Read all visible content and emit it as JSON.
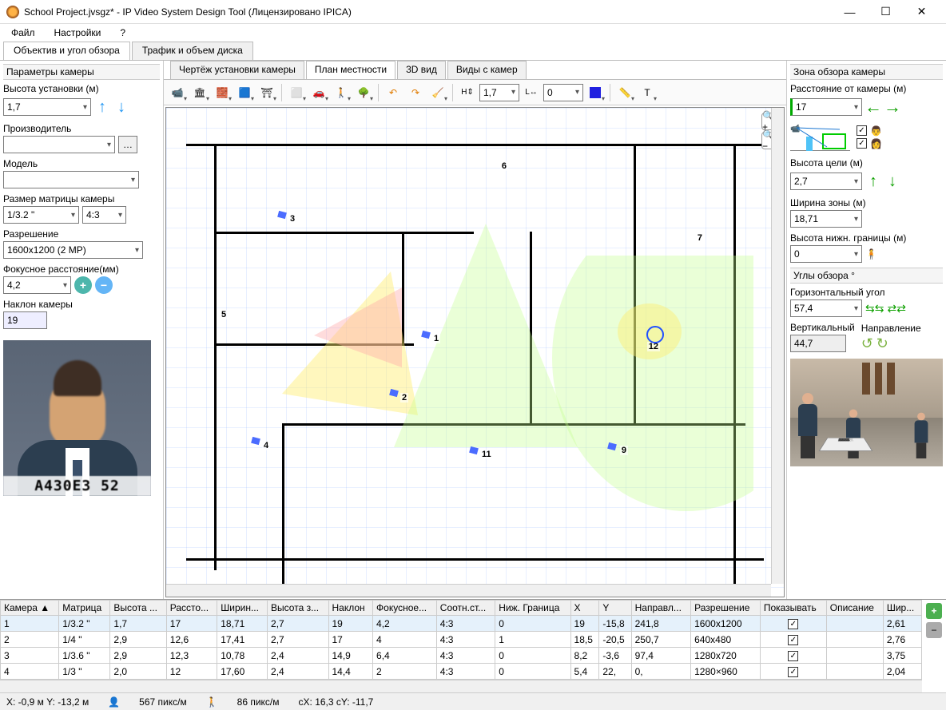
{
  "title": "School Project.jvsgz* - IP Video System Design Tool (Лицензировано  IPICA)",
  "menu": {
    "file": "Файл",
    "settings": "Настройки",
    "help": "?"
  },
  "topTabs": {
    "t1": "Объектив и угол обзора",
    "t2": "Трафик и объем диска"
  },
  "leftPanel": {
    "header": "Параметры камеры",
    "installHeight_label": "Высота установки (м)",
    "installHeight": "1,7",
    "manufacturer_label": "Производитель",
    "manufacturer": "",
    "model_label": "Модель",
    "model": "",
    "sensor_label": "Размер матрицы камеры",
    "sensor": "1/3.2 \"",
    "aspect": "4:3",
    "resolution_label": "Разрешение",
    "resolution": "1600x1200 (2 MP)",
    "focal_label": "Фокусное расстояние(мм)",
    "focal": "4,2",
    "tilt_label": "Наклон камеры",
    "tilt": "19",
    "plate": "A430E3 52"
  },
  "centerTabs": {
    "t1": "Чертёж установки камеры",
    "t2": "План местности",
    "t3": "3D вид",
    "t4": "Виды с камер"
  },
  "toolbar": {
    "h": "H⇕",
    "hval": "1,7",
    "l": "L↔",
    "lval": "0"
  },
  "cameras": [
    "1",
    "2",
    "3",
    "4",
    "5",
    "6",
    "7",
    "9",
    "11",
    "12"
  ],
  "rightPanel": {
    "header1": "Зона обзора камеры",
    "distance_label": "Расстояние от камеры (м)",
    "distance": "17",
    "targetHeight_label": "Высота цели (м)",
    "targetHeight": "2,7",
    "zoneWidth_label": "Ширина зоны (м)",
    "zoneWidth": "18,71",
    "lowerBound_label": "Высота нижн. границы (м)",
    "lowerBound": "0",
    "header2": "Углы обзора °",
    "horizAngle_label": "Горизонтальный угол",
    "horizAngle": "57,4",
    "vertAngle_label": "Вертикальный",
    "vertAngle": "44,7",
    "direction_label": "Направление"
  },
  "table": {
    "headers": [
      "Камера ▲",
      "Матрица",
      "Высота ...",
      "Рассто...",
      "Ширин...",
      "Высота з...",
      "Наклон",
      "Фокусное...",
      "Соотн.ст...",
      "Ниж. Граница",
      "X",
      "Y",
      "Направл...",
      "Разрешение",
      "Показывать",
      "Описание",
      "Шир..."
    ],
    "rows": [
      {
        "cam": "1",
        "sensor": "1/3.2 \"",
        "h": "1,7",
        "d": "17",
        "w": "18,71",
        "th": "2,7",
        "tilt": "19",
        "f": "4,2",
        "ar": "4:3",
        "lb": "0",
        "x": "19",
        "y": "-15,8",
        "dir": "241,8",
        "res": "1600x1200",
        "show": true,
        "desc": "",
        "wid": "2,61"
      },
      {
        "cam": "2",
        "sensor": "1/4 \"",
        "h": "2,9",
        "d": "12,6",
        "w": "17,41",
        "th": "2,7",
        "tilt": "17",
        "f": "4",
        "ar": "4:3",
        "lb": "1",
        "x": "18,5",
        "y": "-20,5",
        "dir": "250,7",
        "res": "640x480",
        "show": true,
        "desc": "",
        "wid": "2,76"
      },
      {
        "cam": "3",
        "sensor": "1/3.6 \"",
        "h": "2,9",
        "d": "12,3",
        "w": "10,78",
        "th": "2,4",
        "tilt": "14,9",
        "f": "6,4",
        "ar": "4:3",
        "lb": "0",
        "x": "8,2",
        "y": "-3,6",
        "dir": "97,4",
        "res": "1280x720",
        "show": true,
        "desc": "",
        "wid": "3,75"
      },
      {
        "cam": "4",
        "sensor": "1/3 \"",
        "h": "2,0",
        "d": "12",
        "w": "17,60",
        "th": "2,4",
        "tilt": "14,4",
        "f": "2",
        "ar": "4:3",
        "lb": "0",
        "x": "5,4",
        "y": "22,",
        "dir": "0,",
        "res": "1280×960",
        "show": true,
        "desc": "",
        "wid": "2,04"
      }
    ]
  },
  "statusbar": {
    "xy": "X: -0,9 м     Y: -13,2 м",
    "px1": "567 пикс/м",
    "px2": "86 пикс/м",
    "cxy": "cX: 16,3 cY: -11,7"
  }
}
